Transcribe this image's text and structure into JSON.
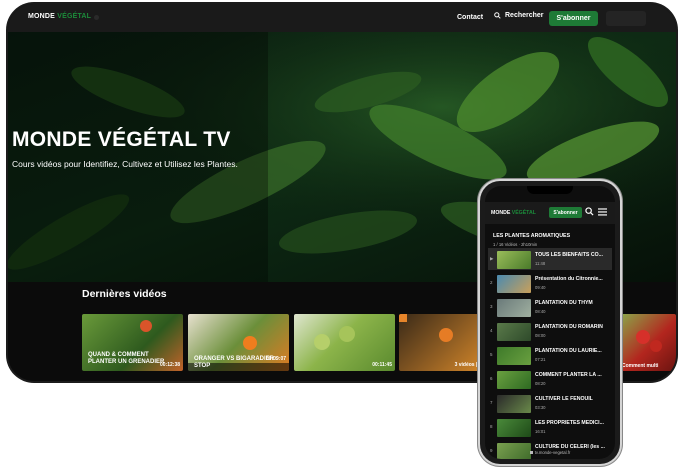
{
  "header": {
    "logo_primary": "MONDE",
    "logo_accent": "VÉGÉTAL",
    "nav_contact": "Contact",
    "nav_search": "Rechercher",
    "subscribe_label": "S'abonner"
  },
  "hero": {
    "title": "MONDE VÉGÉTAL TV",
    "subtitle": "Cours vidéos pour Identifiez, Cultivez et Utilisez les Plantes."
  },
  "latest": {
    "title": "Dernières vidéos",
    "videos": [
      {
        "caption_line1": "QUAND & COMMENT",
        "caption_line2": "PLANTER UN GRENADIER",
        "duration": "00:12:38"
      },
      {
        "caption_line1": "ORANGER VS BIGARADIER : STOP",
        "caption_line2": "",
        "duration": "00:09:07"
      },
      {
        "caption_line1": "",
        "caption_line2": "",
        "duration": "00:11:45"
      },
      {
        "caption_line1": "",
        "caption_line2": "",
        "duration": "3 vidéos | 00:"
      },
      {
        "caption_line1": "Comment multi",
        "caption_line2": "",
        "duration": ""
      }
    ]
  },
  "phone": {
    "logo_primary": "MONDE",
    "logo_accent": "VÉGÉTAL",
    "subscribe_label": "S'abonner",
    "playlist_title": "LES PLANTES AROMATIQUES",
    "playlist_meta": "1 / 16 Vidéos  ·  2h10min",
    "items": [
      {
        "title": "TOUS LES BIENFAITS CO...",
        "duration": "11:48"
      },
      {
        "title": "Présentation du Citronnie...",
        "duration": "09:40"
      },
      {
        "title": "PLANTATION DU THYM",
        "duration": "08:40"
      },
      {
        "title": "PLANTATION DU ROMARIN",
        "duration": "08:00"
      },
      {
        "title": "PLANTATION DU LAURIE...",
        "duration": "07:21"
      },
      {
        "title": "COMMENT PLANTER LA ...",
        "duration": "08:20"
      },
      {
        "title": "CULTIVER LE FENOUIL",
        "duration": "03:30"
      },
      {
        "title": "LES PROPRIÉTÉS MÉDICI...",
        "duration": "16:01"
      },
      {
        "title": "CULTURE DU CELERI (les ...",
        "duration": ""
      }
    ],
    "url": "tv.monde-vegetal.fr"
  },
  "colors": {
    "accent": "#1e7a36",
    "background": "#0b0b0b",
    "bar": "#1a1a1a"
  }
}
